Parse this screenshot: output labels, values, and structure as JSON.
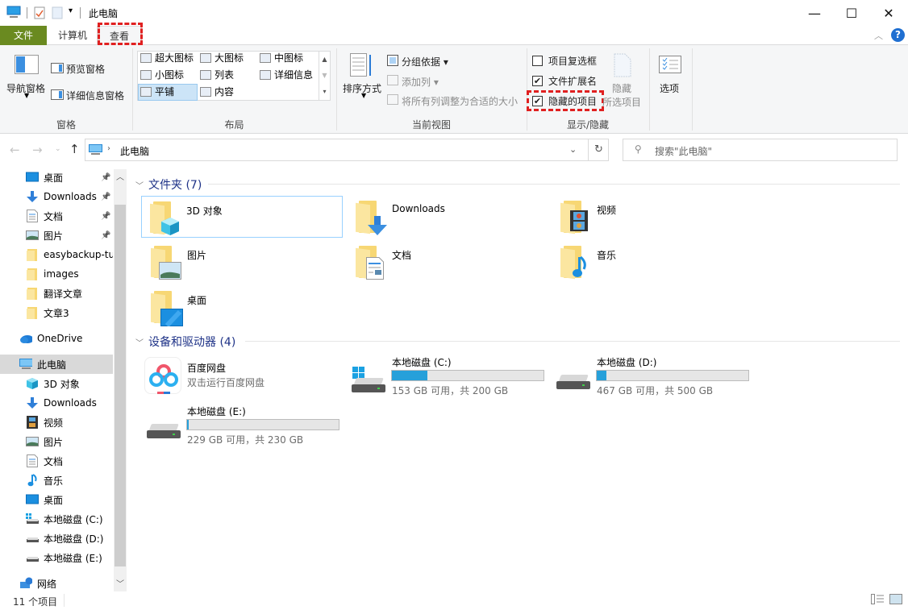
{
  "window": {
    "title": "此电脑",
    "controls": {
      "minimize": "—",
      "maximize": "☐",
      "close": "✕"
    }
  },
  "tabs": [
    {
      "label": "文件",
      "active": false
    },
    {
      "label": "计算机",
      "active": false
    },
    {
      "label": "查看",
      "active": true,
      "highlighted": true
    }
  ],
  "ribbon": {
    "pane_group": {
      "label": "窗格",
      "nav_pane": "导航窗格",
      "preview_pane": "预览窗格",
      "details_pane": "详细信息窗格"
    },
    "layout_group": {
      "label": "布局",
      "items": [
        "超大图标",
        "大图标",
        "中图标",
        "小图标",
        "列表",
        "详细信息",
        "平铺",
        "内容"
      ],
      "selected": "平铺"
    },
    "current_view_group": {
      "label": "当前视图",
      "sort_by": "排序方式",
      "group_by": "分组依据",
      "add_columns": "添加列",
      "size_columns": "将所有列调整为合适的大小"
    },
    "show_hide_group": {
      "label": "显示/隐藏",
      "item_checkboxes": {
        "label": "项目复选框",
        "checked": false
      },
      "file_extensions": {
        "label": "文件扩展名",
        "checked": true
      },
      "hidden_items": {
        "label": "隐藏的项目",
        "checked": true,
        "highlighted": true
      },
      "hide_selected_line1": "隐藏",
      "hide_selected_line2": "所选项目"
    },
    "options": {
      "label": "选项"
    }
  },
  "address": {
    "path": "此电脑",
    "search_placeholder": "搜索\"此电脑\""
  },
  "sidebar": {
    "quick_access": [
      {
        "label": "桌面",
        "icon": "desktop-icon",
        "pinned": true
      },
      {
        "label": "Downloads",
        "icon": "download-icon",
        "pinned": true
      },
      {
        "label": "文档",
        "icon": "document-icon",
        "pinned": true
      },
      {
        "label": "图片",
        "icon": "picture-icon",
        "pinned": true
      },
      {
        "label": "easybackup-tu",
        "icon": "folder-icon",
        "pinned": false
      },
      {
        "label": "images",
        "icon": "folder-icon",
        "pinned": false
      },
      {
        "label": "翻译文章",
        "icon": "folder-icon",
        "pinned": false
      },
      {
        "label": "文章3",
        "icon": "folder-icon",
        "pinned": false
      }
    ],
    "onedrive": "OneDrive",
    "this_pc": "此电脑",
    "this_pc_children": [
      {
        "label": "3D 对象",
        "icon": "cube-icon"
      },
      {
        "label": "Downloads",
        "icon": "download-icon"
      },
      {
        "label": "视频",
        "icon": "video-icon"
      },
      {
        "label": "图片",
        "icon": "picture-icon"
      },
      {
        "label": "文档",
        "icon": "document-icon"
      },
      {
        "label": "音乐",
        "icon": "music-icon"
      },
      {
        "label": "桌面",
        "icon": "desktop-icon"
      },
      {
        "label": "本地磁盘 (C:)",
        "icon": "system-drive-icon"
      },
      {
        "label": "本地磁盘 (D:)",
        "icon": "drive-icon"
      },
      {
        "label": "本地磁盘 (E:)",
        "icon": "drive-icon"
      }
    ],
    "network": "网络"
  },
  "content": {
    "folders_header": "文件夹 (7)",
    "folders": [
      {
        "label": "3D 对象",
        "icon": "cube-icon"
      },
      {
        "label": "Downloads",
        "icon": "download-icon"
      },
      {
        "label": "视频",
        "icon": "video-icon"
      },
      {
        "label": "图片",
        "icon": "picture-icon"
      },
      {
        "label": "文档",
        "icon": "document-icon"
      },
      {
        "label": "音乐",
        "icon": "music-icon"
      },
      {
        "label": "桌面",
        "icon": "desktop-icon"
      }
    ],
    "devices_header": "设备和驱动器 (4)",
    "baidu": {
      "label": "百度网盘",
      "sub": "双击运行百度网盘"
    },
    "drives": [
      {
        "label": "本地磁盘 (C:)",
        "free": "153 GB 可用，共 200 GB",
        "used_fraction": 0.235,
        "system": true
      },
      {
        "label": "本地磁盘 (D:)",
        "free": "467 GB 可用，共 500 GB",
        "used_fraction": 0.066,
        "system": false
      },
      {
        "label": "本地磁盘 (E:)",
        "free": "229 GB 可用，共 230 GB",
        "used_fraction": 0.004,
        "system": false
      }
    ]
  },
  "status": {
    "count": "11 个项目"
  },
  "colors": {
    "accent": "#26a0da",
    "file_tab": "#6a8a20",
    "highlight": "#e02020",
    "section_header": "#1e3287"
  }
}
